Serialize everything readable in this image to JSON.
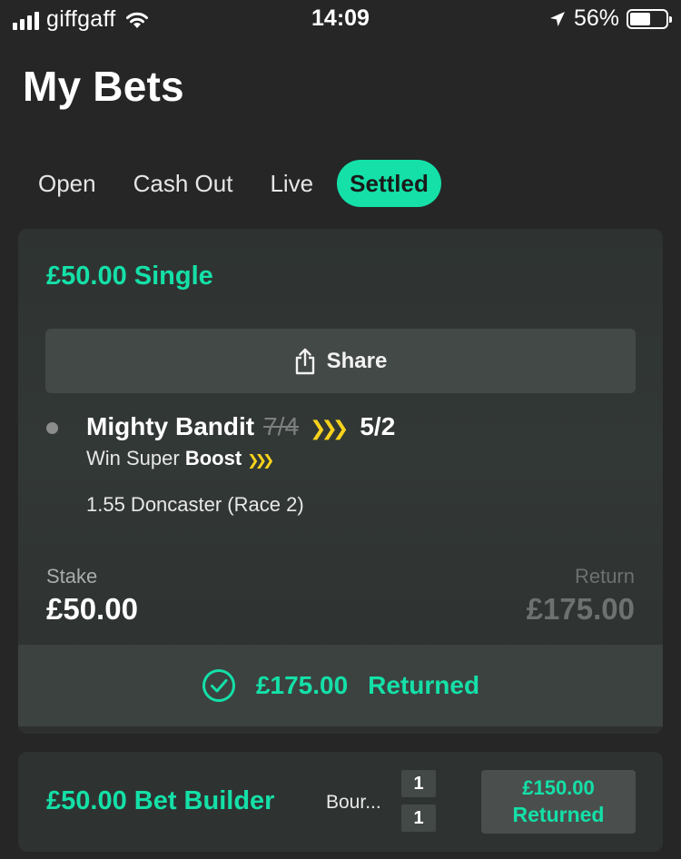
{
  "status_bar": {
    "carrier": "giffgaff",
    "time": "14:09",
    "battery_pct": "56%",
    "battery_level": 0.56,
    "icons": [
      "signal-icon",
      "wifi-icon",
      "location-arrow-icon",
      "battery-icon"
    ]
  },
  "page": {
    "title": "My Bets"
  },
  "tabs": [
    {
      "label": "Open",
      "active": false
    },
    {
      "label": "Cash Out",
      "active": false
    },
    {
      "label": "Live",
      "active": false
    },
    {
      "label": "Settled",
      "active": true
    }
  ],
  "bet1": {
    "title": "£50.00 Single",
    "share_label": "Share",
    "selection": "Mighty Bandit",
    "old_odds": "7/4",
    "new_odds": "5/2",
    "market_prefix": "Win Super ",
    "market_boost": "Boost",
    "event": "1.55 Doncaster (Race 2)",
    "stake_label": "Stake",
    "stake_value": "£50.00",
    "return_label": "Return",
    "return_value": "£175.00",
    "returned_amount": "£175.00",
    "returned_label": "Returned"
  },
  "bet2": {
    "title": "£50.00 Bet Builder",
    "event": "Bour...",
    "score_home": "1",
    "score_away": "1",
    "returned_amount": "£150.00",
    "returned_label": "Returned"
  },
  "colors": {
    "accent": "#14e0a8",
    "boost": "#f7d21c",
    "background": "#262626",
    "card": "#2e3331"
  }
}
